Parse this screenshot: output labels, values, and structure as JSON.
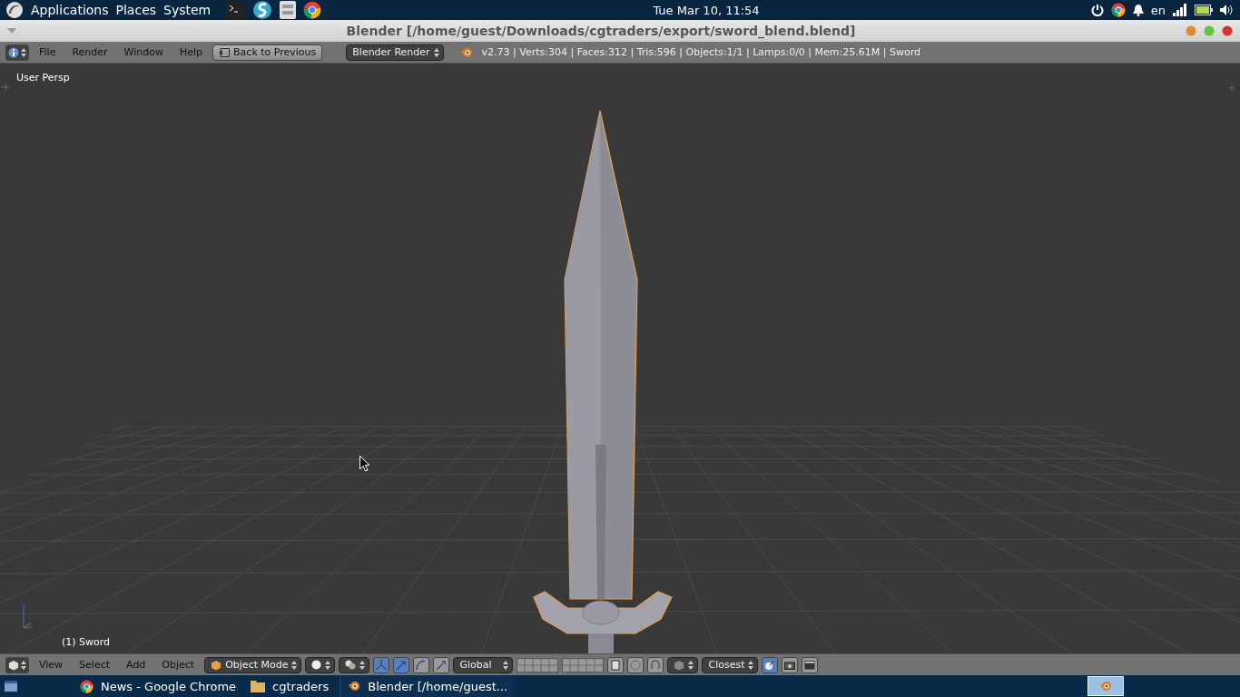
{
  "top_panel": {
    "menus": [
      "Applications",
      "Places",
      "System"
    ],
    "clock": "Tue Mar 10, 11:54",
    "keyboard": "en"
  },
  "window": {
    "title": "Blender [/home/guest/Downloads/cgtraders/export/sword_blend.blend]"
  },
  "info_header": {
    "menus": [
      "File",
      "Render",
      "Window",
      "Help"
    ],
    "back_button": "Back to Previous",
    "engine": "Blender Render",
    "stats": "v2.73 | Verts:304 | Faces:312 | Tris:596 | Objects:1/1 | Lamps:0/0 | Mem:25.61M | Sword"
  },
  "viewport": {
    "view_label": "User Persp",
    "object_label": "(1) Sword"
  },
  "view3d_header": {
    "menus": [
      "View",
      "Select",
      "Add",
      "Object"
    ],
    "mode": "Object Mode",
    "manipulators": [
      {
        "selected": true
      },
      {
        "selected": true
      },
      {
        "selected": false
      },
      {
        "selected": false
      }
    ],
    "orientation": "Global",
    "snap_target": "Closest"
  },
  "taskbar": {
    "items": [
      {
        "label": "News - Google Chrome",
        "kind": "browser",
        "selected": false
      },
      {
        "label": "cgtraders",
        "kind": "folder",
        "selected": false
      },
      {
        "label": "Blender [/home/guest...",
        "kind": "blender",
        "selected": true
      }
    ]
  }
}
